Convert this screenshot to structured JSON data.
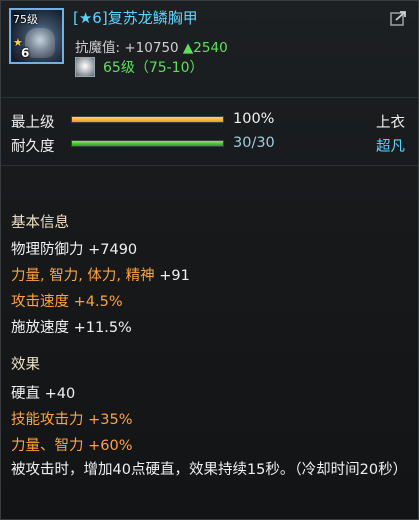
{
  "item": {
    "icon_name": "dragon-scale-armor-icon",
    "icon_level": "75级",
    "icon_star": "★",
    "icon_star_count": "6",
    "title": "[★6]复苏龙鳞胸甲",
    "demon_label": "抗魔值:",
    "demon_value": "+10750",
    "demon_increase": "▲2540",
    "gem_level": "65级（75-10）"
  },
  "bars": [
    {
      "label": "最上级",
      "value_text": "100%",
      "fill_percent": 100,
      "color": "#f0a020",
      "slot": "上衣",
      "slot_color": "#f0f0f0"
    },
    {
      "label": "耐久度",
      "value_text": "30/30",
      "fill_percent": 100,
      "color": "#3fb028",
      "slot": "超凡",
      "slot_color": "#5ad4ff"
    }
  ],
  "basic": {
    "heading": "基本信息",
    "stats": [
      {
        "name": "物理防御力",
        "value": "+7490",
        "color": "#f0f0f0"
      },
      {
        "name": "力量, 智力, 体力, 精神",
        "value": "+91",
        "color": "#ffa43a"
      },
      {
        "name": "攻击速度",
        "value": "+4.5%",
        "color": "#ffa43a"
      },
      {
        "name": "施放速度",
        "value": "+11.5%",
        "color": "#f0f0f0"
      }
    ]
  },
  "effects": {
    "heading": "效果",
    "stats": [
      {
        "name": "硬直",
        "value": "+40",
        "color": "#f0f0f0"
      },
      {
        "name": "技能攻击力",
        "value": "+35%",
        "color": "#ffa43a"
      },
      {
        "name": "力量、智力",
        "value": "+60%",
        "color": "#ffa43a"
      }
    ],
    "description": "被攻击时，增加40点硬直，效果持续15秒。（冷却时间20秒）"
  }
}
